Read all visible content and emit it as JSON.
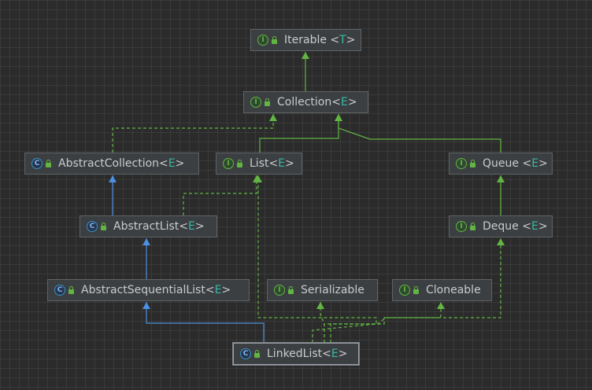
{
  "diagram": {
    "nodes": [
      {
        "id": "iterable",
        "name": "Iterable",
        "type_param": "T",
        "kind": "interface",
        "kind_letter": "I",
        "space_before_bracket": true
      },
      {
        "id": "collection",
        "name": "Collection",
        "type_param": "E",
        "kind": "interface",
        "kind_letter": "I",
        "space_before_bracket": false
      },
      {
        "id": "abstract_collection",
        "name": "AbstractCollection",
        "type_param": "E",
        "kind": "abstract-class",
        "kind_letter": "C",
        "space_before_bracket": false
      },
      {
        "id": "list",
        "name": "List",
        "type_param": "E",
        "kind": "interface",
        "kind_letter": "I",
        "space_before_bracket": false
      },
      {
        "id": "queue",
        "name": "Queue",
        "type_param": "E",
        "kind": "interface",
        "kind_letter": "I",
        "space_before_bracket": true
      },
      {
        "id": "abstract_list",
        "name": "AbstractList",
        "type_param": "E",
        "kind": "abstract-class",
        "kind_letter": "C",
        "space_before_bracket": false
      },
      {
        "id": "deque",
        "name": "Deque",
        "type_param": "E",
        "kind": "interface",
        "kind_letter": "I",
        "space_before_bracket": true
      },
      {
        "id": "abstract_sequential_list",
        "name": "AbstractSequentialList",
        "type_param": "E",
        "kind": "abstract-class",
        "kind_letter": "C",
        "space_before_bracket": false
      },
      {
        "id": "serializable",
        "name": "Serializable",
        "type_param": "",
        "kind": "interface",
        "kind_letter": "I",
        "space_before_bracket": false
      },
      {
        "id": "cloneable",
        "name": "Cloneable",
        "type_param": "",
        "kind": "interface",
        "kind_letter": "I",
        "space_before_bracket": false
      },
      {
        "id": "linked_list",
        "name": "LinkedList",
        "type_param": "E",
        "kind": "class",
        "kind_letter": "C",
        "space_before_bracket": false,
        "selected": true
      }
    ],
    "edges": [
      {
        "from": "collection",
        "to": "iterable",
        "relation": "extends"
      },
      {
        "from": "abstract_collection",
        "to": "collection",
        "relation": "implements"
      },
      {
        "from": "list",
        "to": "collection",
        "relation": "extends"
      },
      {
        "from": "queue",
        "to": "collection",
        "relation": "extends"
      },
      {
        "from": "abstract_list",
        "to": "abstract_collection",
        "relation": "class-extends"
      },
      {
        "from": "abstract_list",
        "to": "list",
        "relation": "implements"
      },
      {
        "from": "deque",
        "to": "queue",
        "relation": "extends"
      },
      {
        "from": "abstract_sequential_list",
        "to": "abstract_list",
        "relation": "class-extends"
      },
      {
        "from": "linked_list",
        "to": "abstract_sequential_list",
        "relation": "class-extends"
      },
      {
        "from": "linked_list",
        "to": "list",
        "relation": "implements"
      },
      {
        "from": "linked_list",
        "to": "deque",
        "relation": "implements"
      },
      {
        "from": "linked_list",
        "to": "serializable",
        "relation": "implements"
      },
      {
        "from": "linked_list",
        "to": "cloneable",
        "relation": "implements"
      }
    ],
    "colors": {
      "background": "#2b2b2b",
      "node_fill": "#3c3f41",
      "interface_green": "#62b543",
      "class_blue": "#3592c4",
      "type_param_teal": "#33b8a6",
      "edge_green": "#62b543",
      "edge_blue": "#4d8fe0"
    }
  }
}
